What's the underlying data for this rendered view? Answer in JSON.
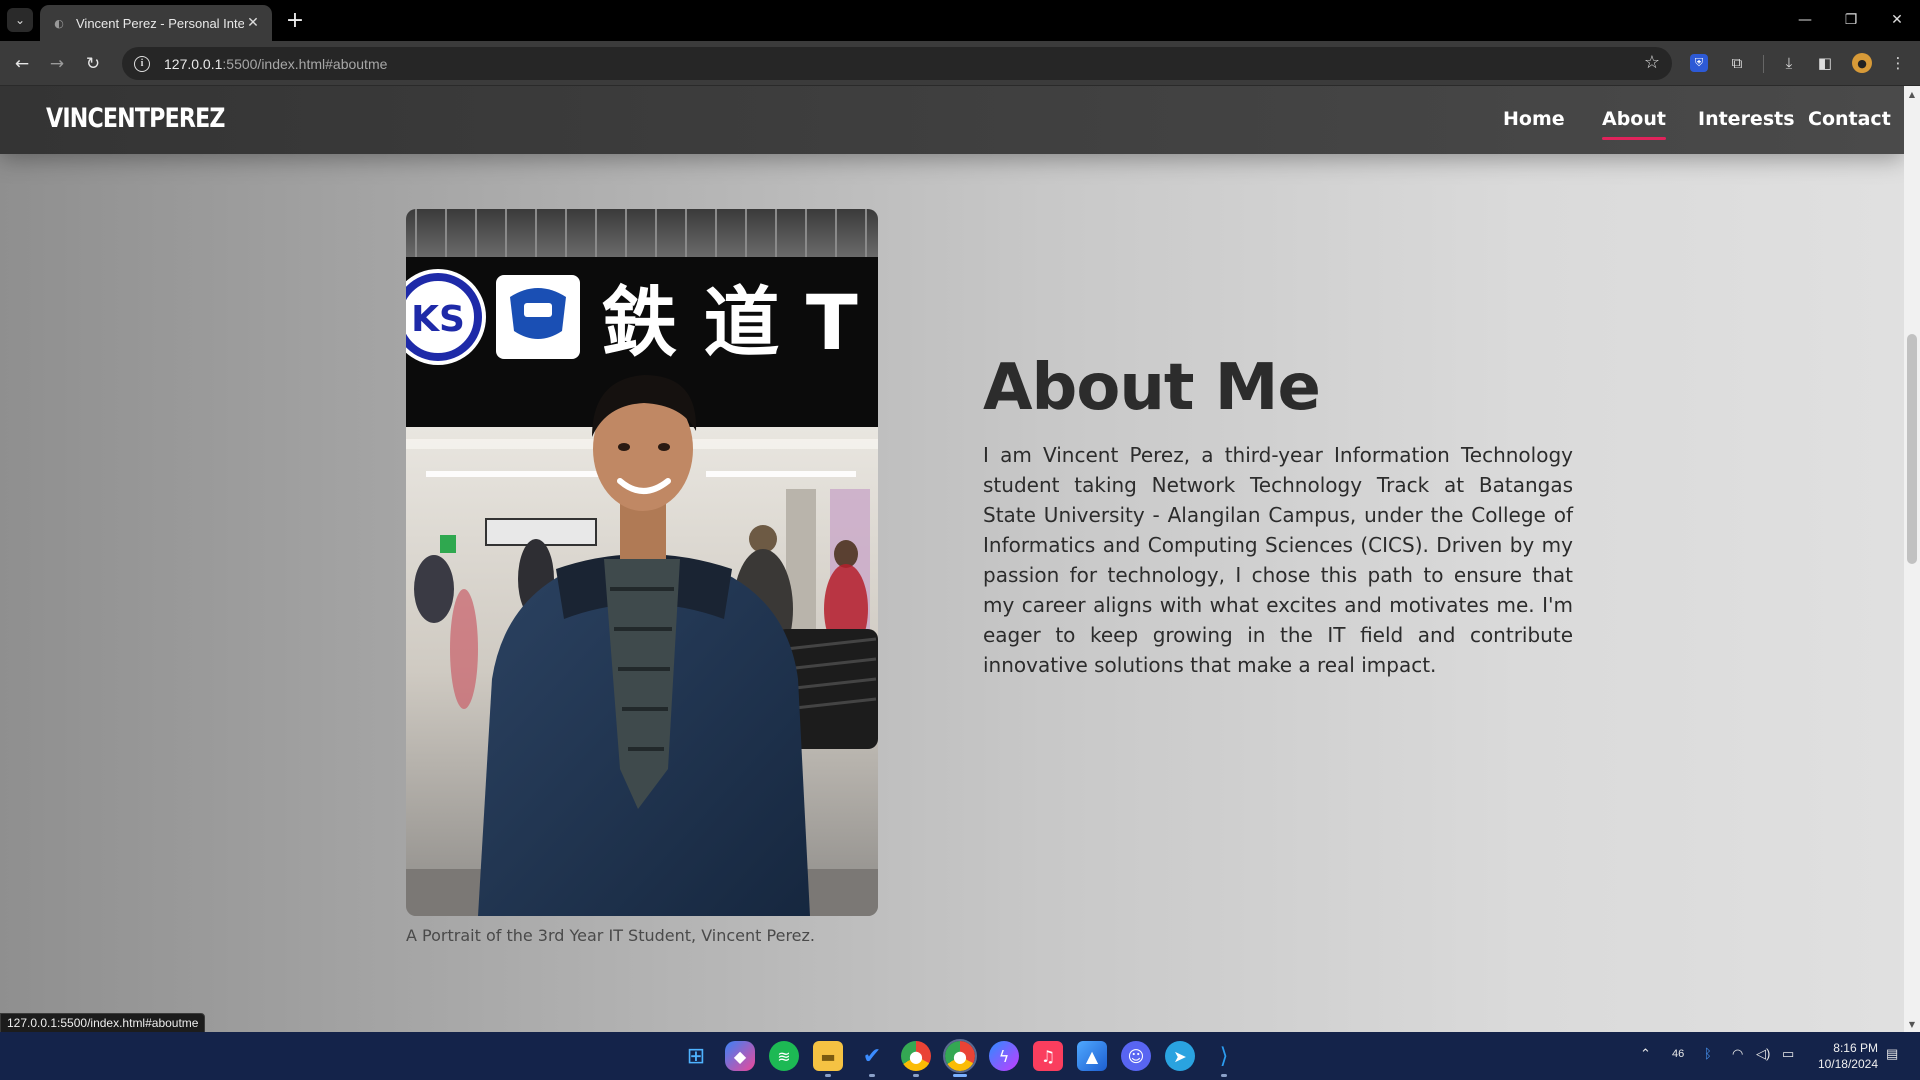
{
  "browser": {
    "tab_title": "Vincent Perez - Personal Interests",
    "url_host": "127.0.0.1",
    "url_rest": ":5500/index.html#aboutme",
    "status_url": "127.0.0.1:5500/index.html#aboutme"
  },
  "site": {
    "logo": "VINCENTPEREZ",
    "nav": [
      "Home",
      "About",
      "Interests",
      "Contact"
    ],
    "active_nav": "About"
  },
  "about": {
    "title": "About Me",
    "text": "I am Vincent Perez, a third-year Information Technology student taking Network Technology Track at Batangas State University - Alangilan Campus, under the College of Informatics and Computing Sciences (CICS). Driven by my passion for technology, I chose this path to ensure that my career aligns with what excites and motivates me. I'm eager to keep growing in the IT field and contribute innovative solutions that make a real impact.",
    "caption": "A Portrait of the 3rd Year IT Student, Vincent Perez.",
    "sign_text": "鉄 道 T",
    "sign_ks": "KS"
  },
  "taskbar": {
    "apps": [
      "start-icon",
      "copilot-icon",
      "spotify-icon",
      "file-explorer-icon",
      "todo-icon",
      "chrome-icon",
      "chrome-profile-icon",
      "messenger-icon",
      "music-icon",
      "photos-icon",
      "discord-icon",
      "telegram-icon",
      "vscode-icon"
    ],
    "tray_badge": "46",
    "time": "8:16 PM",
    "date": "10/18/2024"
  },
  "colors": {
    "accent": "#e0235b",
    "header_bg": "#3e3e3e",
    "taskbar_bg": "#14234a"
  }
}
